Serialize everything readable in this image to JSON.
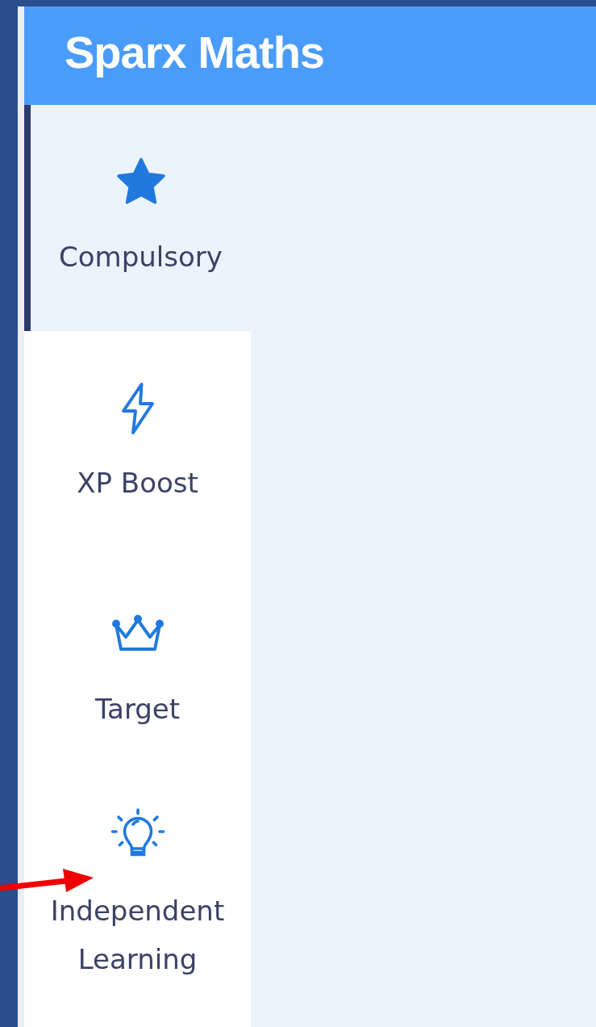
{
  "header": {
    "title": "Sparx Maths"
  },
  "nav": [
    {
      "kind": "star",
      "label": "Compulsory",
      "selected": true
    },
    {
      "kind": "bolt",
      "label": "XP Boost",
      "selected": false
    },
    {
      "kind": "crown",
      "label": "Target",
      "selected": false
    },
    {
      "kind": "bulb",
      "label": "Independent Learning",
      "selected": false
    }
  ]
}
